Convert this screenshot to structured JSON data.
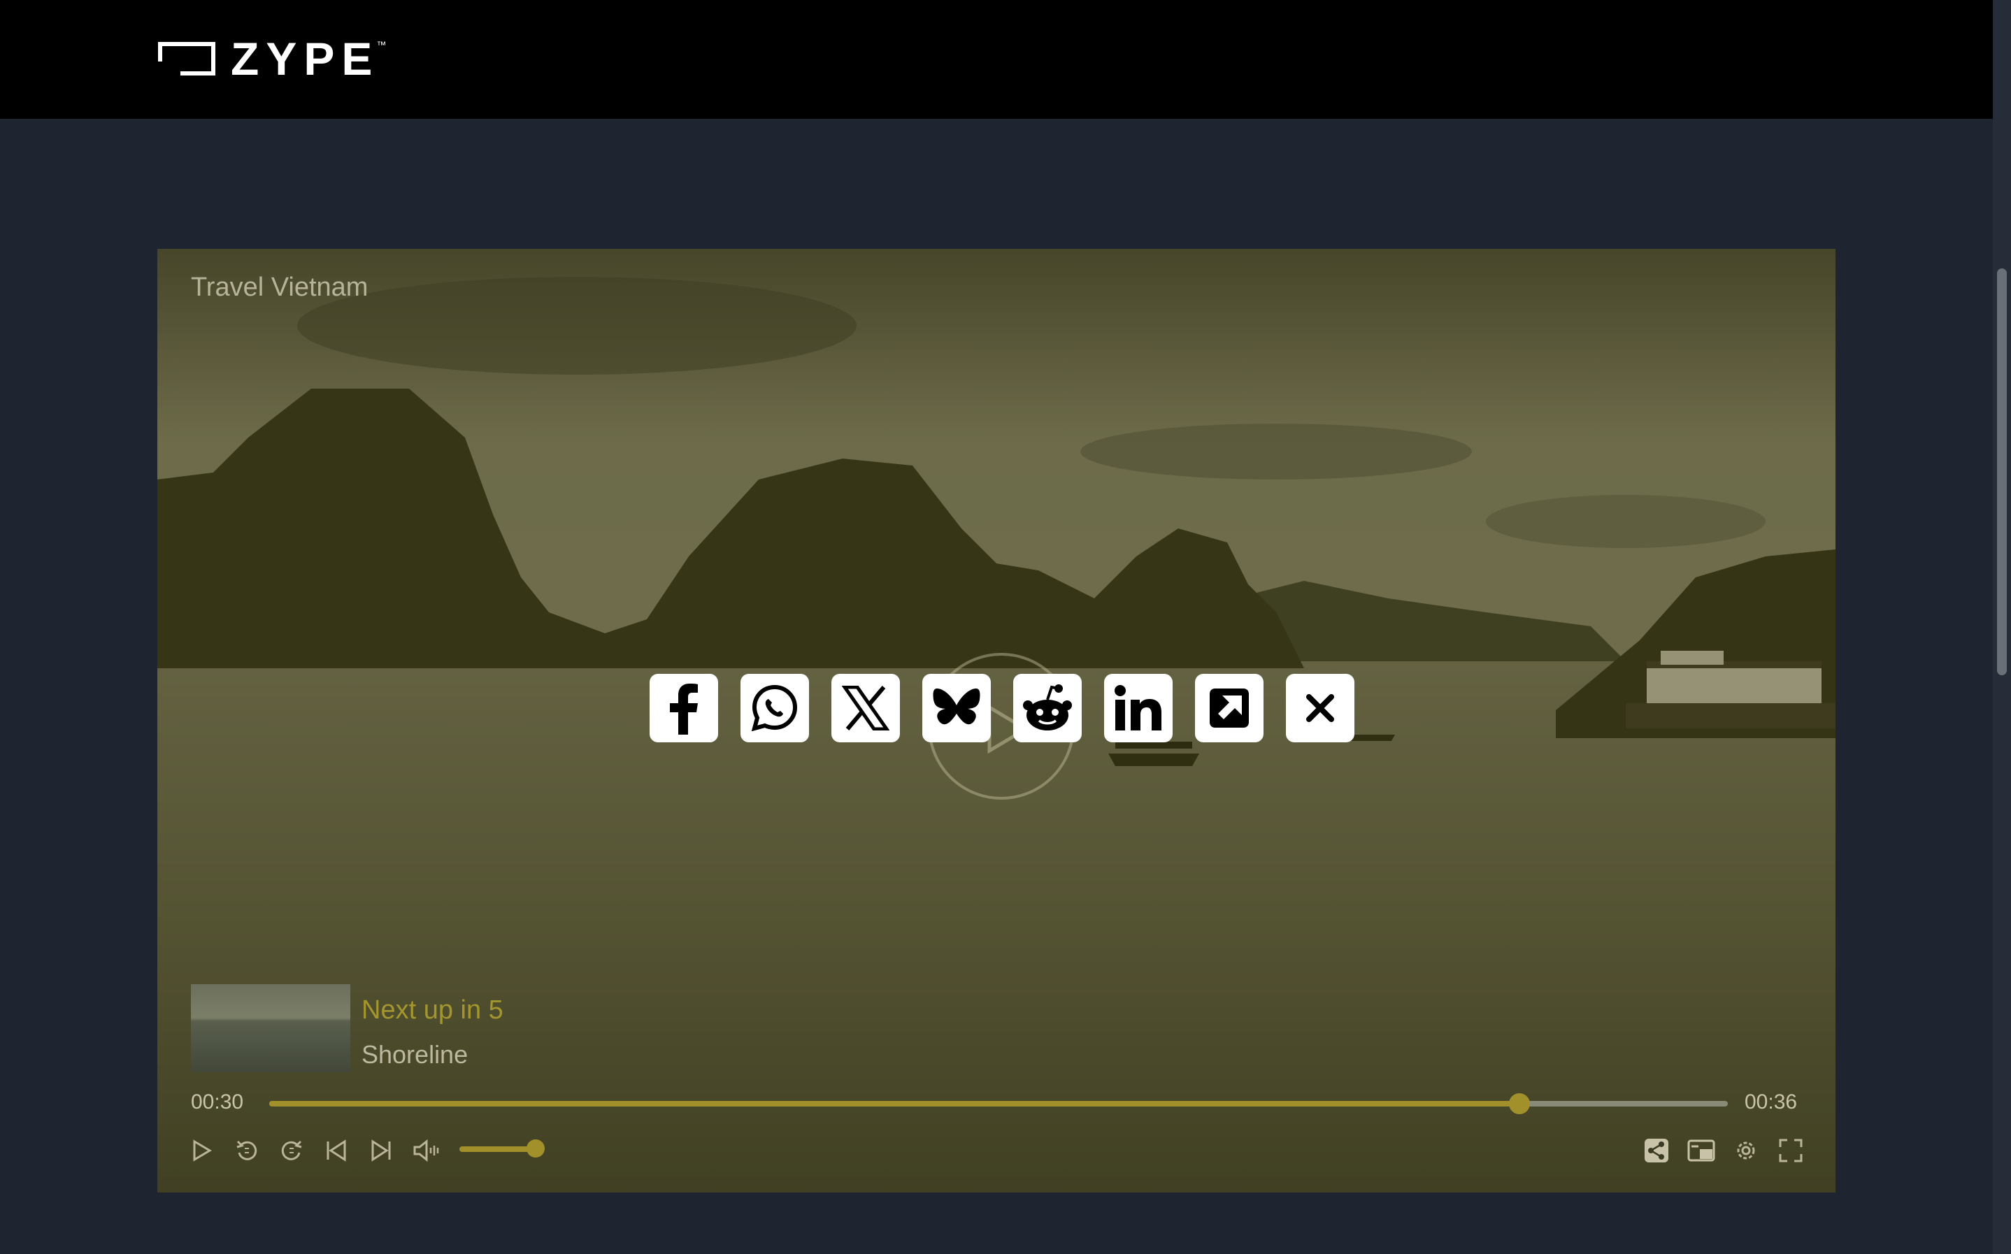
{
  "brand": {
    "name": "ZYPE",
    "trademark": "™"
  },
  "player": {
    "title": "Travel Vietnam",
    "current_time": "00:30",
    "duration": "00:36",
    "progress_fraction": 0.857,
    "volume_fraction": 0.9,
    "accent_color": "#a2912a",
    "next_up": {
      "label": "Next up in 5",
      "title": "Shoreline"
    },
    "share_options": [
      "facebook-icon",
      "whatsapp-icon",
      "x-icon",
      "bluesky-icon",
      "reddit-icon",
      "linkedin-icon",
      "external-link-icon",
      "close-icon"
    ],
    "controls_left": [
      "play-icon",
      "rewind-icon",
      "forward-icon",
      "previous-icon",
      "next-icon",
      "volume-icon"
    ],
    "controls_right": [
      "share-icon",
      "picture-in-picture-icon",
      "settings-icon",
      "fullscreen-icon"
    ]
  }
}
